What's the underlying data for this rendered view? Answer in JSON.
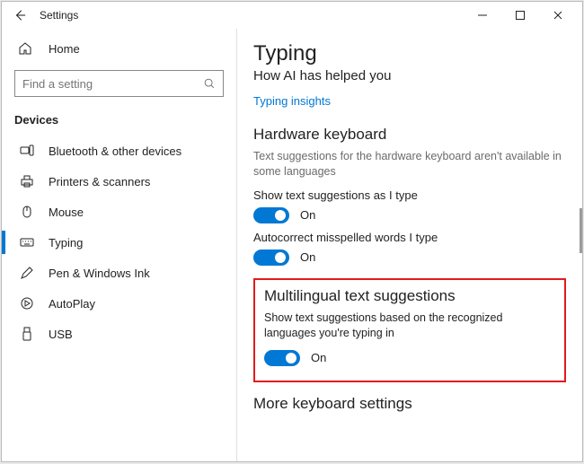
{
  "window": {
    "title": "Settings"
  },
  "sidebar": {
    "home_label": "Home",
    "search_placeholder": "Find a setting",
    "section_label": "Devices",
    "items": [
      {
        "label": "Bluetooth & other devices"
      },
      {
        "label": "Printers & scanners"
      },
      {
        "label": "Mouse"
      },
      {
        "label": "Typing"
      },
      {
        "label": "Pen & Windows Ink"
      },
      {
        "label": "AutoPlay"
      },
      {
        "label": "USB"
      }
    ]
  },
  "main": {
    "title": "Typing",
    "subtitle": "How AI has helped you",
    "link": "Typing insights",
    "hardware": {
      "heading": "Hardware keyboard",
      "desc": "Text suggestions for the hardware keyboard aren't available in some languages",
      "sugg_label": "Show text suggestions as I type",
      "sugg_state": "On",
      "auto_label": "Autocorrect misspelled words I type",
      "auto_state": "On"
    },
    "multi": {
      "heading": "Multilingual text suggestions",
      "desc": "Show text suggestions based on the recognized languages you're typing in",
      "state": "On"
    },
    "more_heading": "More keyboard settings"
  }
}
